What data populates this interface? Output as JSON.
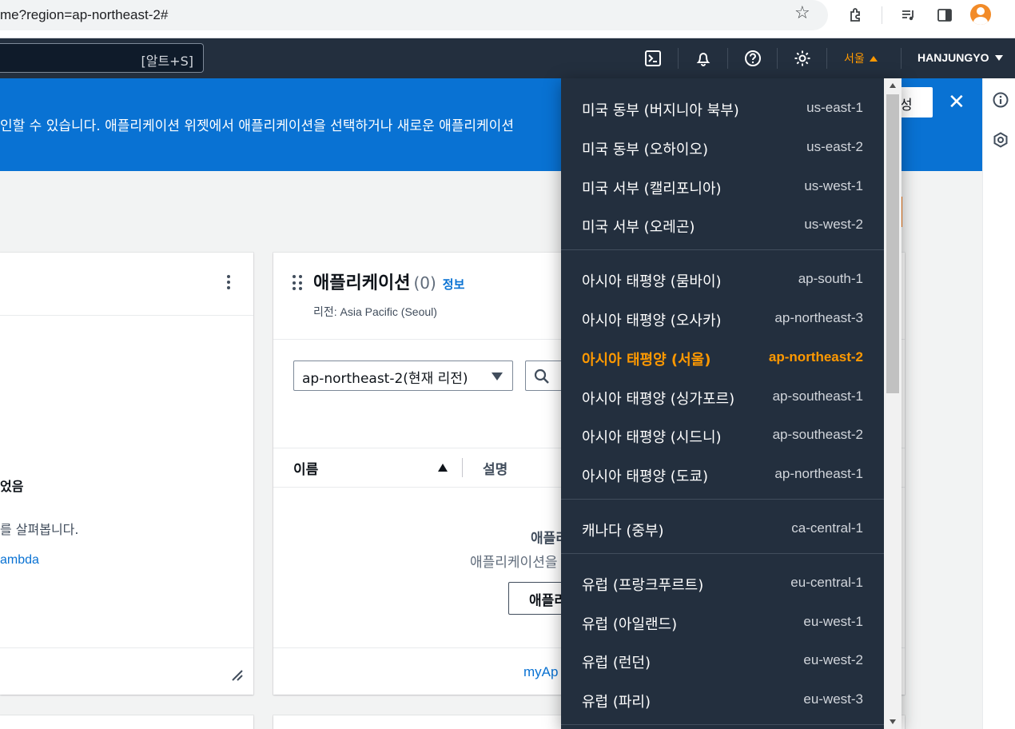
{
  "browser": {
    "url": "me?region=ap-northeast-2#"
  },
  "topnav": {
    "search_shortcut": "[알트+S]",
    "region_label": "서울",
    "user_label": "HANJUNGYO"
  },
  "banner": {
    "text": "인할 수 있습니다. 애플리케이션 위젯에서 애플리케이션을 선택하거나 새로운 애플리케이션",
    "button_label": "성",
    "close_icon": "close-icon"
  },
  "widget_left": {
    "empty_title": "었음",
    "empty_desc": "를 살펴봅니다.",
    "link": "ambda"
  },
  "widget_apps": {
    "title": "애플리케이션",
    "count": "(0)",
    "info_link": "정보",
    "region_sub": "리전: Asia Pacific (Seoul)",
    "select_value": "ap-northeast-2(현재 리전)",
    "col_name": "이름",
    "col_desc": "설명",
    "empty_title": "애플리",
    "empty_desc": "애플리케이션을",
    "create_button": "애플리",
    "footer_link": "myAp"
  },
  "region_menu": {
    "accent_color": "#ff9900",
    "groups": [
      {
        "items": [
          {
            "name": "미국 동부 (버지니아 북부)",
            "code": "us-east-1"
          },
          {
            "name": "미국 동부 (오하이오)",
            "code": "us-east-2"
          },
          {
            "name": "미국 서부 (캘리포니아)",
            "code": "us-west-1"
          },
          {
            "name": "미국 서부 (오레곤)",
            "code": "us-west-2"
          }
        ]
      },
      {
        "items": [
          {
            "name": "아시아 태평양 (뭄바이)",
            "code": "ap-south-1"
          },
          {
            "name": "아시아 태평양 (오사카)",
            "code": "ap-northeast-3"
          },
          {
            "name": "아시아 태평양 (서울)",
            "code": "ap-northeast-2",
            "selected": true
          },
          {
            "name": "아시아 태평양 (싱가포르)",
            "code": "ap-southeast-1"
          },
          {
            "name": "아시아 태평양 (시드니)",
            "code": "ap-southeast-2"
          },
          {
            "name": "아시아 태평양 (도쿄)",
            "code": "ap-northeast-1"
          }
        ]
      },
      {
        "items": [
          {
            "name": "캐나다 (중부)",
            "code": "ca-central-1"
          }
        ]
      },
      {
        "items": [
          {
            "name": "유럽 (프랑크푸르트)",
            "code": "eu-central-1"
          },
          {
            "name": "유럽 (아일랜드)",
            "code": "eu-west-1"
          },
          {
            "name": "유럽 (런던)",
            "code": "eu-west-2"
          },
          {
            "name": "유럽 (파리)",
            "code": "eu-west-3"
          }
        ]
      }
    ]
  }
}
